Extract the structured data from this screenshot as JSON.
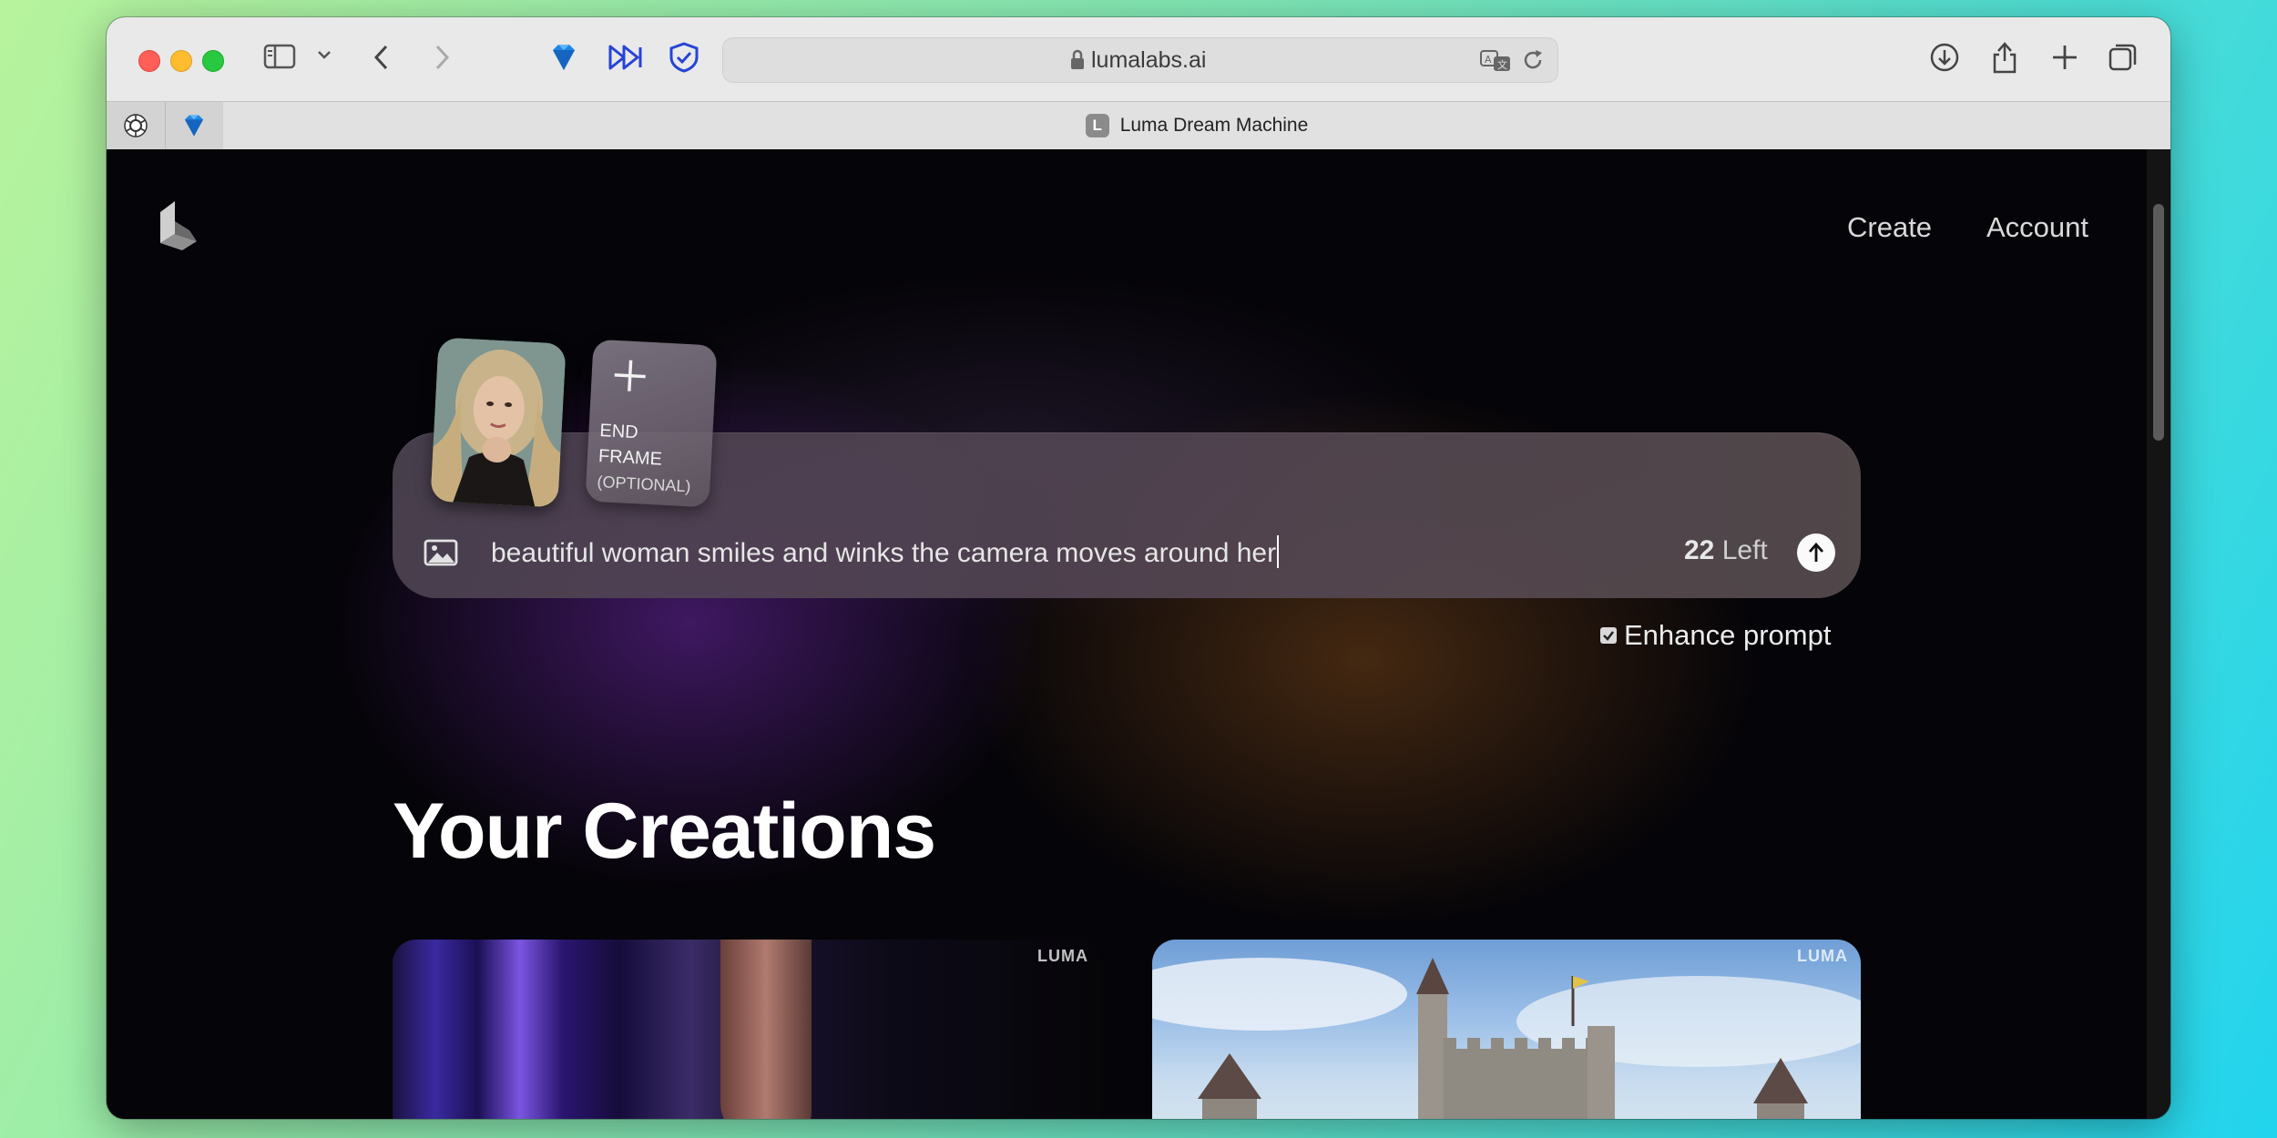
{
  "browser": {
    "url": "lumalabs.ai",
    "active_tab_title": "Luma Dream Machine",
    "active_tab_favicon_letter": "L",
    "pinned_tabs": [
      "chatgpt-icon",
      "diamond-icon"
    ],
    "toolbar_icons": [
      "sidebar-icon",
      "chevron-down-icon",
      "back-icon",
      "forward-icon",
      "diamond-extension-icon",
      "fast-forward-extension-icon",
      "shield-extension-icon",
      "translate-icon",
      "reload-icon",
      "download-icon",
      "share-icon",
      "new-tab-icon",
      "tab-overview-icon"
    ]
  },
  "nav": {
    "create": "Create",
    "account": "Account"
  },
  "prompt": {
    "end_frame_line1": "END",
    "end_frame_line2": "FRAME",
    "end_frame_optional": "(OPTIONAL)",
    "text": "beautiful woman smiles and winks the camera moves around her",
    "remaining_count": "22",
    "remaining_label": "Left",
    "enhance_label": "Enhance prompt",
    "enhance_checked": true
  },
  "creations": {
    "heading": "Your Creations",
    "watermark": "LUMA"
  },
  "colors": {
    "page_bg": "#050408",
    "accent_purple": "#6e28aa",
    "accent_amber": "#784619"
  }
}
